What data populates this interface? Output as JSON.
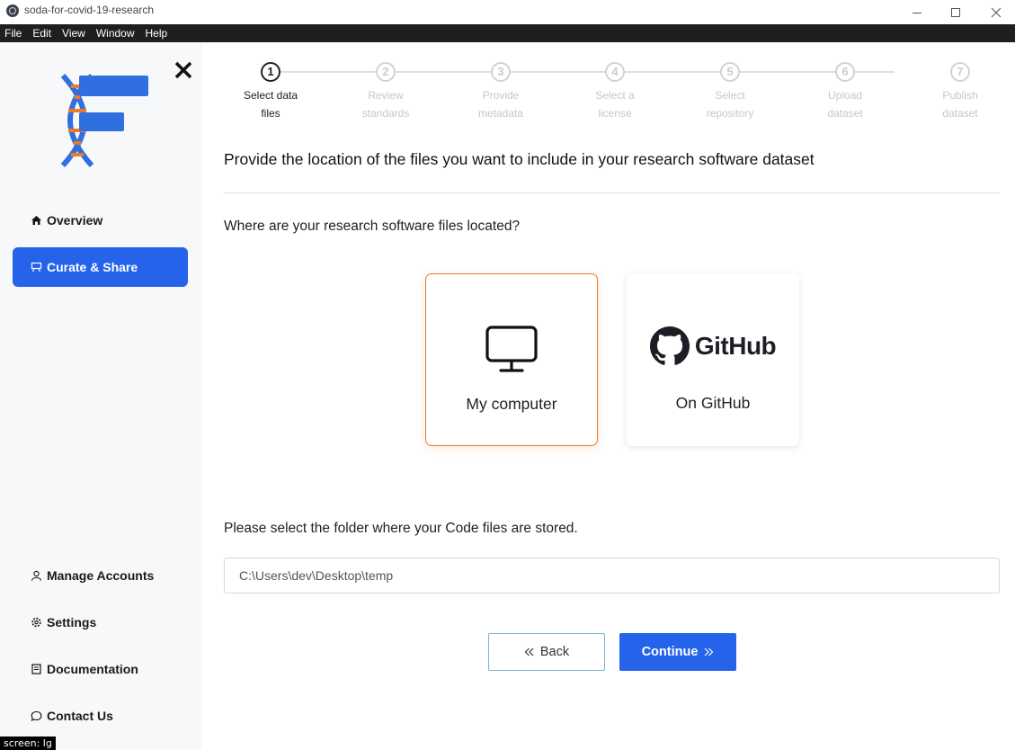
{
  "window": {
    "title": "soda-for-covid-19-research",
    "controls": [
      "minimize-icon",
      "maximize-icon",
      "close-icon"
    ]
  },
  "menu": [
    "File",
    "Edit",
    "View",
    "Window",
    "Help"
  ],
  "sidebar": {
    "top_items": [
      {
        "label": "Overview",
        "icon": "home-icon"
      },
      {
        "label": "Curate & Share",
        "icon": "curate-icon",
        "active": true
      }
    ],
    "bottom_items": [
      {
        "label": "Manage Accounts",
        "icon": "user-icon"
      },
      {
        "label": "Settings",
        "icon": "gear-icon"
      },
      {
        "label": "Documentation",
        "icon": "book-icon"
      },
      {
        "label": "Contact Us",
        "icon": "chat-icon"
      }
    ]
  },
  "steps": [
    {
      "number": "1",
      "label": "Select data\nfiles",
      "active": true
    },
    {
      "number": "2",
      "label": "Review\nstandards"
    },
    {
      "number": "3",
      "label": "Provide\nmetadata"
    },
    {
      "number": "4",
      "label": "Select a\nlicense"
    },
    {
      "number": "5",
      "label": "Select\nrepository"
    },
    {
      "number": "6",
      "label": "Upload\ndataset"
    },
    {
      "number": "7",
      "label": "Publish\ndataset"
    }
  ],
  "main": {
    "heading": "Provide the location of the files you want to include in your research software dataset",
    "question": "Where are your research software files located?",
    "options": [
      {
        "label": "My computer",
        "icon": "monitor-icon",
        "selected": true
      },
      {
        "label": "On GitHub",
        "icon": "github-logo",
        "logo_text": "GitHub"
      }
    ],
    "folder_prompt": "Please select the folder where your Code files are stored.",
    "folder_path": "C:\\Users\\dev\\Desktop\\temp",
    "back_label": "Back",
    "continue_label": "Continue"
  },
  "colors": {
    "accent": "#2563eb",
    "selected_border": "#f07a22",
    "logo_blue": "#2f6fe0",
    "logo_orange": "#f07a22"
  },
  "screen_tag": "screen: lg"
}
